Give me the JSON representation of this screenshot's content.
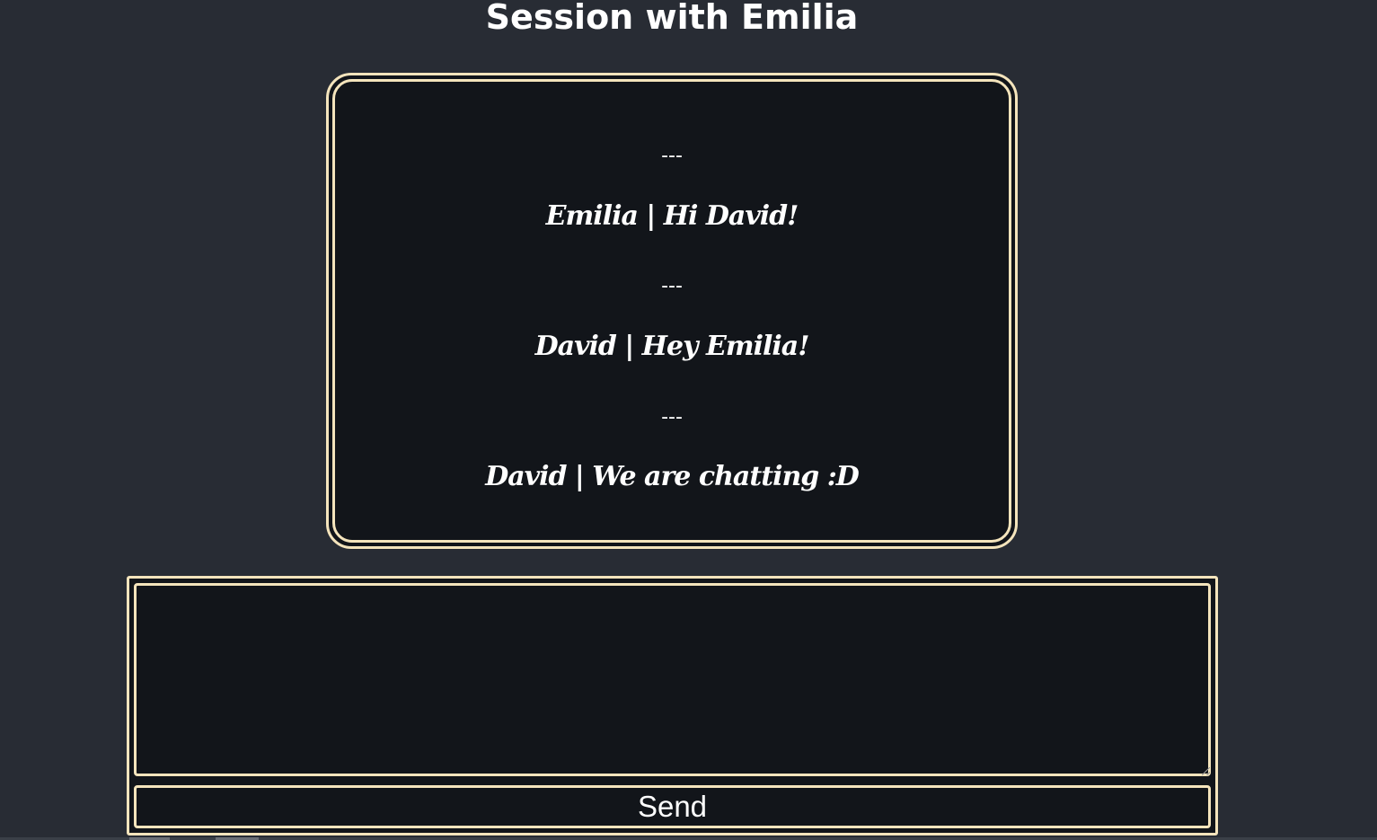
{
  "page": {
    "title": "Session with Emilia"
  },
  "chat": {
    "lines": [
      {
        "kind": "separator",
        "text": "---"
      },
      {
        "kind": "message",
        "text": "Emilia | Hi David!"
      },
      {
        "kind": "separator",
        "text": "---"
      },
      {
        "kind": "message",
        "text": "David | Hey Emilia!"
      },
      {
        "kind": "separator",
        "text": "---"
      },
      {
        "kind": "message",
        "text": "David | We are chatting :D"
      }
    ]
  },
  "compose": {
    "input_value": "",
    "send_label": "Send"
  },
  "colors": {
    "page_background": "#282c34",
    "panel_background": "#12151a",
    "border_accent": "#f4e4bc",
    "text": "#ffffff"
  }
}
